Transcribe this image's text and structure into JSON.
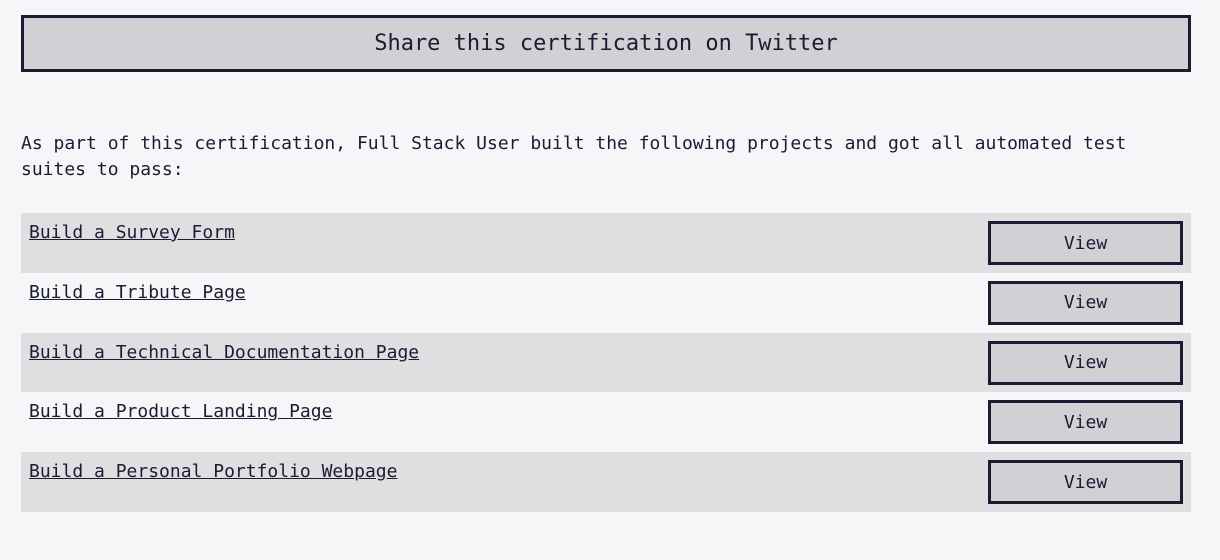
{
  "share": {
    "label": "Share this certification on Twitter"
  },
  "intro": {
    "text": "As part of this certification, Full Stack User built the following projects and got all automated test suites to pass:"
  },
  "projects": [
    {
      "title": "Build a Survey Form",
      "button": "View"
    },
    {
      "title": "Build a Tribute Page",
      "button": "View"
    },
    {
      "title": "Build a Technical Documentation Page",
      "button": "View"
    },
    {
      "title": "Build a Product Landing Page",
      "button": "View"
    },
    {
      "title": "Build a Personal Portfolio Webpage",
      "button": "View"
    }
  ]
}
